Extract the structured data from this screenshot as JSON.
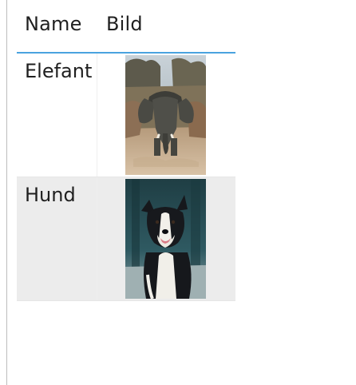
{
  "table": {
    "columns": [
      "Name",
      "Bild"
    ],
    "rows": [
      {
        "name": "Elefant",
        "image": "elephant-photo"
      },
      {
        "name": "Hund",
        "image": "dog-photo"
      }
    ]
  },
  "colors": {
    "header_underline": "#4aa3df",
    "alt_row_background": "#ececec"
  }
}
